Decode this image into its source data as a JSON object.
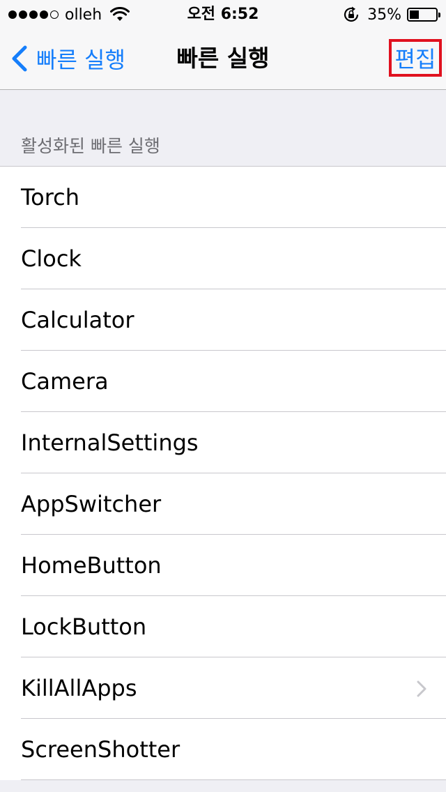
{
  "status_bar": {
    "carrier": "olleh",
    "signal_bars_filled": 4,
    "signal_bars_total": 5,
    "time": "오전 6:52",
    "battery_percent": "35%",
    "battery_level": 0.35,
    "icons": [
      "wifi-icon",
      "rotation-lock-icon",
      "battery-icon"
    ]
  },
  "nav": {
    "back_label": "빠른 실행",
    "title": "빠른 실행",
    "edit_label": "편집",
    "accent_color": "#157efb",
    "highlight_color": "#e0111f"
  },
  "section": {
    "header": "활성화된 빠른 실행"
  },
  "items": [
    {
      "label": "Torch",
      "chevron": false
    },
    {
      "label": "Clock",
      "chevron": false
    },
    {
      "label": "Calculator",
      "chevron": false
    },
    {
      "label": "Camera",
      "chevron": false
    },
    {
      "label": "InternalSettings",
      "chevron": false
    },
    {
      "label": "AppSwitcher",
      "chevron": false
    },
    {
      "label": "HomeButton",
      "chevron": false
    },
    {
      "label": "LockButton",
      "chevron": false
    },
    {
      "label": "KillAllApps",
      "chevron": true
    },
    {
      "label": "ScreenShotter",
      "chevron": false
    }
  ]
}
